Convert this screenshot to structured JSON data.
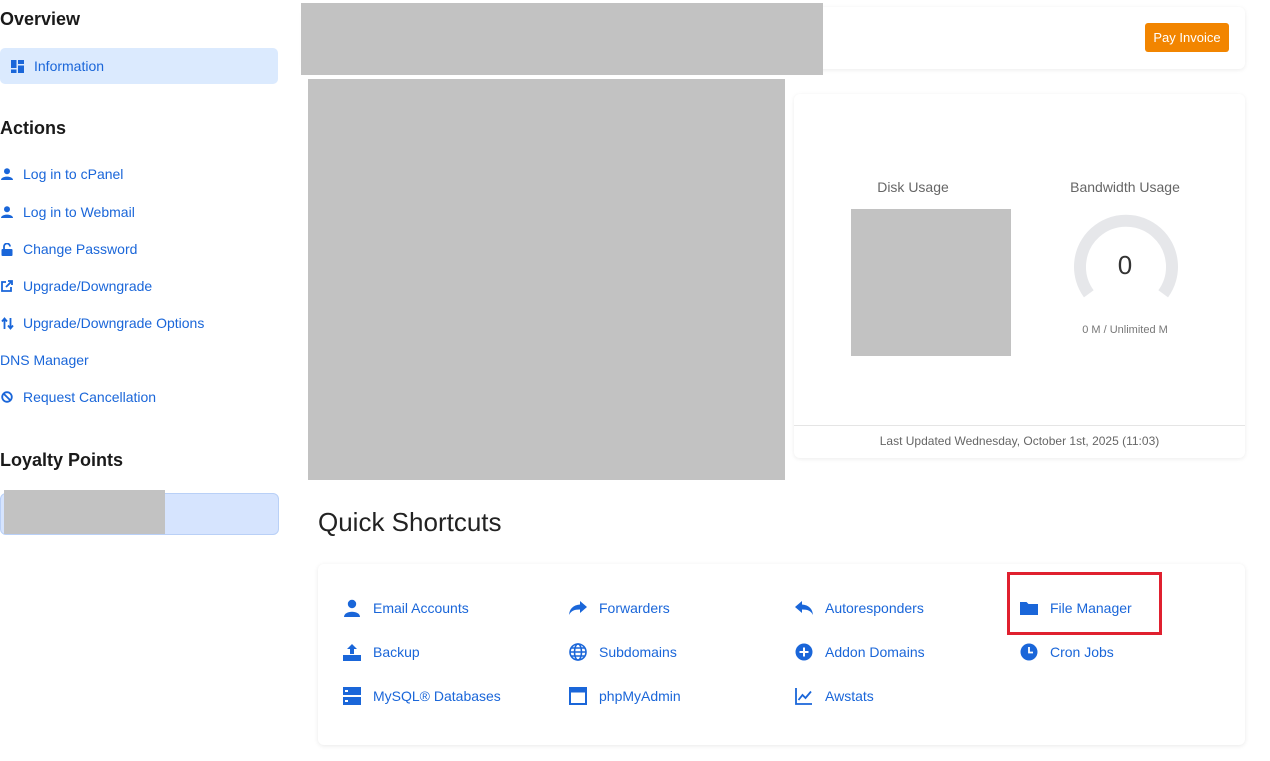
{
  "sidebar": {
    "overview_heading": "Overview",
    "information_label": "Information",
    "actions_heading": "Actions",
    "actions": [
      {
        "label": "Log in to cPanel",
        "icon": "user-icon"
      },
      {
        "label": "Log in to Webmail",
        "icon": "user-icon"
      },
      {
        "label": "Change Password",
        "icon": "unlock-icon"
      },
      {
        "label": "Upgrade/Downgrade",
        "icon": "external-link-icon"
      },
      {
        "label": "Upgrade/Downgrade Options",
        "icon": "sort-arrows-icon"
      },
      {
        "label": "DNS Manager",
        "icon": ""
      },
      {
        "label": "Request Cancellation",
        "icon": "ban-icon"
      }
    ],
    "loyalty_heading": "Loyalty Points"
  },
  "header": {
    "pay_invoice_label": "Pay Invoice"
  },
  "usage": {
    "disk_title": "Disk Usage",
    "bandwidth_title": "Bandwidth Usage",
    "bandwidth_value": "0",
    "bandwidth_sub": "0 M / Unlimited M",
    "last_updated": "Last Updated Wednesday, October 1st, 2025 (11:03)"
  },
  "quick_shortcuts": {
    "title": "Quick Shortcuts",
    "items": [
      {
        "label": "Email Accounts",
        "icon": "user-icon"
      },
      {
        "label": "Forwarders",
        "icon": "share-arrow-icon"
      },
      {
        "label": "Autoresponders",
        "icon": "reply-arrow-icon"
      },
      {
        "label": "File Manager",
        "icon": "folder-icon"
      },
      {
        "label": "Backup",
        "icon": "upload-tray-icon"
      },
      {
        "label": "Subdomains",
        "icon": "globe-icon"
      },
      {
        "label": "Addon Domains",
        "icon": "plus-circle-icon"
      },
      {
        "label": "Cron Jobs",
        "icon": "clock-icon"
      },
      {
        "label": "MySQL® Databases",
        "icon": "server-icon"
      },
      {
        "label": "phpMyAdmin",
        "icon": "browser-window-icon"
      },
      {
        "label": "Awstats",
        "icon": "line-chart-icon"
      }
    ]
  },
  "colors": {
    "accent": "#1a66d9",
    "pay_button": "#f28500",
    "highlight": "#e0202f"
  }
}
